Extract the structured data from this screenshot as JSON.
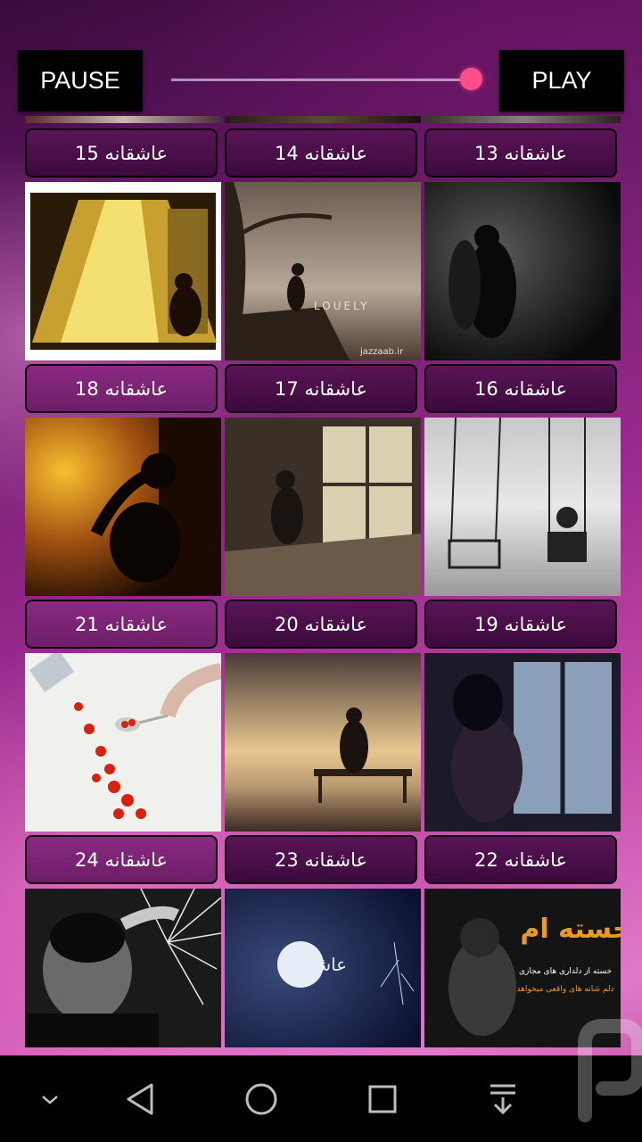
{
  "controls": {
    "pause_label": "PAUSE",
    "play_label": "PLAY",
    "progress_fraction": 1.0
  },
  "grid": {
    "items": [
      {
        "label": "عاشقانه 15",
        "thumb_colors": [
          "#f0d060",
          "#2a1a08"
        ]
      },
      {
        "label": "عاشقانه 14",
        "thumb_colors": [
          "#b8a898",
          "#3a2e24"
        ]
      },
      {
        "label": "عاشقانه 13",
        "thumb_colors": [
          "#3a3a3a",
          "#0a0a0a"
        ]
      },
      {
        "label": "عاشقانه 18",
        "thumb_colors": [
          "#e0a020",
          "#1a0a02"
        ]
      },
      {
        "label": "عاشقانه 17",
        "thumb_colors": [
          "#c8c0a0",
          "#2a2018"
        ]
      },
      {
        "label": "عاشقانه 16",
        "thumb_colors": [
          "#d8d8d8",
          "#9a9a9a"
        ]
      },
      {
        "label": "عاشقانه 21",
        "thumb_colors": [
          "#f0f0ec",
          "#d02010"
        ]
      },
      {
        "label": "عاشقانه 20",
        "thumb_colors": [
          "#e8c890",
          "#3a2a22"
        ]
      },
      {
        "label": "عاشقانه 19",
        "thumb_colors": [
          "#8aa0b8",
          "#1a1a28"
        ]
      },
      {
        "label": "عاشقانه 24",
        "thumb_colors": [
          "#c8c8c8",
          "#101010"
        ]
      },
      {
        "label": "عاشقانه 23",
        "thumb_colors": [
          "#1a2a5a",
          "#0a1030"
        ]
      },
      {
        "label": "عاشقانه 22",
        "thumb_colors": [
          "#2a2a2a",
          "#0a0a0a"
        ]
      }
    ]
  },
  "thumb_text": {
    "item14_caption": "LOUELY",
    "item14_watermark": "jazzaab.ir",
    "item22_headline": "خسته ام",
    "item22_line1": "خسته از دلداری های مجازی",
    "item22_line2": "دلم شانه های واقعی میخواهد",
    "item23_title": "عاشقم"
  },
  "navbar": {
    "icons": [
      "chevron-down-icon",
      "back-triangle-icon",
      "home-circle-icon",
      "recents-square-icon",
      "download-tray-icon"
    ]
  }
}
